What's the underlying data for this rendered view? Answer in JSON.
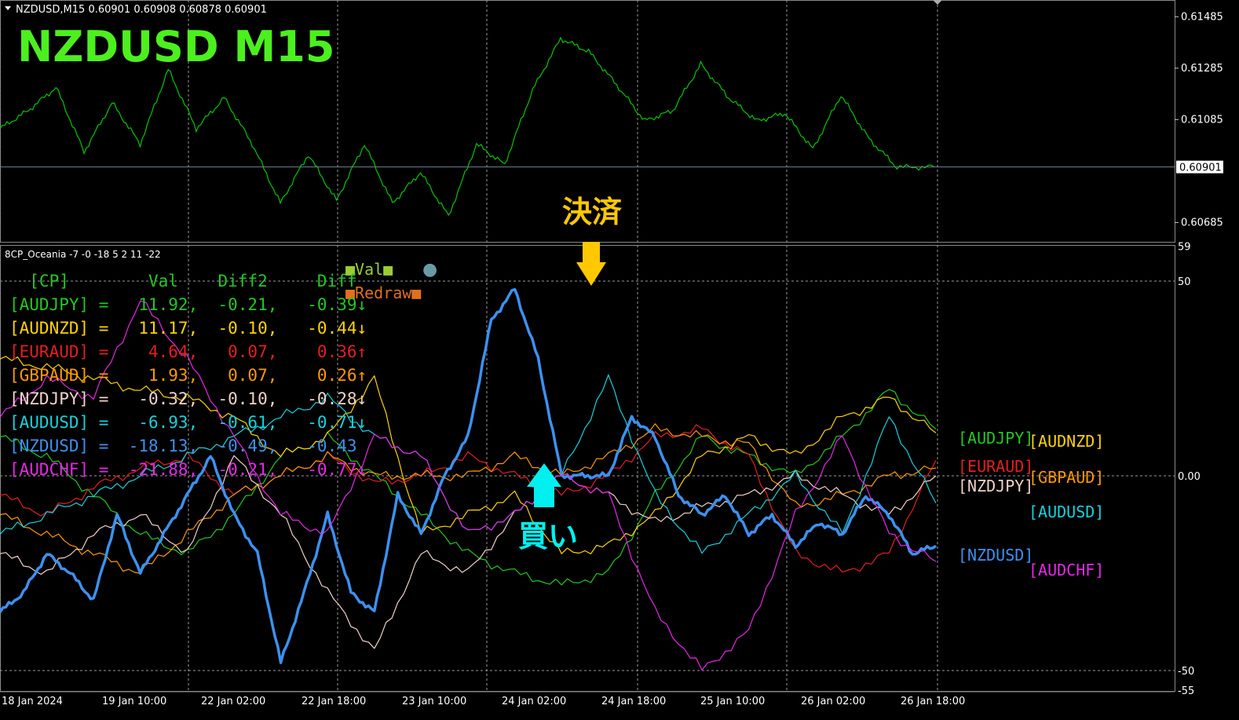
{
  "window": {
    "header": "NZDUSD,M15  0.60901 0.60908 0.60878 0.60901",
    "big_title": "NZDUSD  M15",
    "indicator_header": "8CP_Oceania -7 -0 -18 5 2 11 -22"
  },
  "price_axis": {
    "ticks": [
      "0.61485",
      "0.61285",
      "0.61085",
      "0.60685"
    ],
    "current_price": "0.60901"
  },
  "indicator_axis": {
    "ticks": [
      "59",
      "50",
      "0.00",
      "-50",
      "-55"
    ]
  },
  "time_axis": {
    "labels": [
      "18 Jan 2024",
      "19 Jan 10:00",
      "22 Jan 02:00",
      "22 Jan 18:00",
      "23 Jan 10:00",
      "24 Jan 02:00",
      "24 Jan 18:00",
      "25 Jan 10:00",
      "26 Jan 02:00",
      "26 Jan 18:00"
    ]
  },
  "annotations": {
    "settle": "決済",
    "buy": "買い",
    "legend_val": "■Val■",
    "legend_dot": "●",
    "legend_redraw": "■Redraw■"
  },
  "colors": {
    "price": "#00c800",
    "AUDJPY": "#22c822",
    "AUDNZD": "#ffd400",
    "EURAUD": "#e61e1e",
    "GBPAUD": "#ff9900",
    "NZDJPY": "#f0d2c8",
    "AUDUSD": "#17d2dc",
    "NZDUSD": "#3c91f0",
    "AUDCHF": "#e628e6",
    "cyan_arrow": "#00f0f0",
    "gold_arrow": "#ffc800"
  },
  "table": {
    "header": [
      "[CP]",
      "Val",
      "Diff2",
      "Diff"
    ],
    "rows": [
      {
        "pair": "[AUDJPY]",
        "val": "11.92,",
        "diff2": "-0.21,",
        "diff": "-0.39",
        "arrow": "↓",
        "color": "#22c822"
      },
      {
        "pair": "[AUDNZD]",
        "val": "11.17,",
        "diff2": "-0.10,",
        "diff": "-0.44",
        "arrow": "↓",
        "color": "#ffd400"
      },
      {
        "pair": "[EURAUD]",
        "val": "4.64,",
        "diff2": "0.07,",
        "diff": "0.36",
        "arrow": "↑",
        "color": "#e61e1e"
      },
      {
        "pair": "[GBPAUD]",
        "val": "1.93,",
        "diff2": "0.07,",
        "diff": "0.26",
        "arrow": "↑",
        "color": "#ff9900"
      },
      {
        "pair": "[NZDJPY]",
        "val": "-0.32,",
        "diff2": "-0.10,",
        "diff": "-0.28",
        "arrow": "↓",
        "color": "#f0d2c8"
      },
      {
        "pair": "[AUDUSD]",
        "val": "-6.93,",
        "diff2": "-0.61,",
        "diff": "-0.71",
        "arrow": "↓",
        "color": "#17d2dc"
      },
      {
        "pair": "[NZDUSD]",
        "val": "-18.13,",
        "diff2": "-0.49,",
        "diff": "-0.43",
        "arrow": "",
        "color": "#3c91f0"
      },
      {
        "pair": "[AUDCHF]",
        "val": "-21.88,",
        "diff2": "-0.21,",
        "diff": "-0.77",
        "arrow": "↓",
        "color": "#e628e6"
      }
    ]
  },
  "right_labels": [
    "[AUDJPY]",
    "[AUDNZD]",
    "[EURAUD]",
    "[GBPAUD]",
    "[NZDJPY]",
    "[AUDUSD]",
    "[NZDUSD]",
    "[AUDCHF]"
  ],
  "chart_data": [
    {
      "type": "line",
      "name": "NZDUSD M15",
      "ylim": [
        0.6061,
        0.6155
      ],
      "x": [
        0,
        0.03,
        0.06,
        0.09,
        0.12,
        0.15,
        0.18,
        0.21,
        0.24,
        0.27,
        0.3,
        0.33,
        0.36,
        0.39,
        0.42,
        0.45,
        0.48,
        0.51,
        0.54,
        0.57,
        0.6,
        0.63,
        0.66,
        0.69,
        0.72,
        0.75,
        0.78,
        0.81,
        0.84,
        0.87,
        0.9,
        0.93,
        0.96,
        1.0
      ],
      "values": [
        0.6105,
        0.6112,
        0.6121,
        0.6096,
        0.6115,
        0.6099,
        0.6128,
        0.6105,
        0.6117,
        0.6099,
        0.6076,
        0.6095,
        0.6077,
        0.6099,
        0.6076,
        0.6088,
        0.6071,
        0.6099,
        0.6091,
        0.612,
        0.614,
        0.6135,
        0.6122,
        0.6108,
        0.6112,
        0.613,
        0.6117,
        0.6108,
        0.6111,
        0.6097,
        0.6118,
        0.6101,
        0.609,
        0.60901
      ]
    },
    {
      "type": "line",
      "name": "8CP_Oceania",
      "ylim": [
        -55,
        59
      ],
      "series": [
        {
          "key": "AUDJPY",
          "x": [
            0,
            0.05,
            0.1,
            0.15,
            0.2,
            0.25,
            0.3,
            0.35,
            0.4,
            0.45,
            0.5,
            0.55,
            0.6,
            0.65,
            0.7,
            0.75,
            0.8,
            0.85,
            0.9,
            0.95,
            1.0
          ],
          "values": [
            10,
            5,
            -5,
            -15,
            -20,
            -10,
            5,
            10,
            0,
            -10,
            -20,
            -25,
            -28,
            -25,
            -5,
            10,
            5,
            0,
            10,
            22,
            12
          ]
        },
        {
          "key": "AUDNZD",
          "x": [
            0,
            0.05,
            0.1,
            0.15,
            0.2,
            0.25,
            0.3,
            0.35,
            0.4,
            0.45,
            0.5,
            0.55,
            0.6,
            0.65,
            0.7,
            0.75,
            0.8,
            0.85,
            0.9,
            0.95,
            1.0
          ],
          "values": [
            30,
            28,
            25,
            22,
            20,
            15,
            5,
            10,
            25,
            -15,
            -10,
            -5,
            -20,
            -18,
            -10,
            5,
            10,
            5,
            15,
            20,
            11
          ]
        },
        {
          "key": "EURAUD",
          "x": [
            0,
            0.05,
            0.1,
            0.15,
            0.2,
            0.25,
            0.3,
            0.35,
            0.4,
            0.45,
            0.5,
            0.55,
            0.6,
            0.65,
            0.7,
            0.75,
            0.8,
            0.85,
            0.9,
            0.95,
            1.0
          ],
          "values": [
            -5,
            -10,
            -3,
            2,
            5,
            -5,
            0,
            5,
            -2,
            0,
            5,
            0,
            -5,
            0,
            10,
            12,
            5,
            -20,
            -25,
            -20,
            4
          ]
        },
        {
          "key": "GBPAUD",
          "x": [
            0,
            0.05,
            0.1,
            0.15,
            0.2,
            0.25,
            0.3,
            0.35,
            0.4,
            0.45,
            0.5,
            0.55,
            0.6,
            0.65,
            0.7,
            0.75,
            0.8,
            0.85,
            0.9,
            0.95,
            1.0
          ],
          "values": [
            -10,
            -15,
            -20,
            -25,
            -15,
            -5,
            0,
            5,
            0,
            0,
            0,
            5,
            0,
            5,
            12,
            10,
            8,
            -8,
            -5,
            0,
            2
          ]
        },
        {
          "key": "NZDJPY",
          "x": [
            0,
            0.05,
            0.1,
            0.15,
            0.2,
            0.25,
            0.3,
            0.35,
            0.4,
            0.45,
            0.5,
            0.55,
            0.6,
            0.65,
            0.7,
            0.75,
            0.8,
            0.85,
            0.9,
            0.95,
            1.0
          ],
          "values": [
            -20,
            -25,
            -15,
            -10,
            -20,
            5,
            -10,
            -30,
            -45,
            -20,
            -25,
            -10,
            0,
            -5,
            -12,
            -8,
            -5,
            0,
            -5,
            -10,
            0
          ]
        },
        {
          "key": "AUDUSD",
          "x": [
            0,
            0.05,
            0.1,
            0.15,
            0.2,
            0.25,
            0.3,
            0.35,
            0.4,
            0.45,
            0.5,
            0.55,
            0.6,
            0.65,
            0.7,
            0.75,
            0.8,
            0.85,
            0.9,
            0.95,
            1.0
          ],
          "values": [
            -15,
            -10,
            -5,
            0,
            5,
            10,
            15,
            20,
            10,
            5,
            -15,
            -10,
            0,
            25,
            -5,
            -20,
            -10,
            0,
            -15,
            15,
            -7
          ]
        },
        {
          "key": "NZDUSD",
          "x": [
            0,
            0.025,
            0.05,
            0.075,
            0.1,
            0.125,
            0.15,
            0.175,
            0.2,
            0.225,
            0.25,
            0.275,
            0.3,
            0.325,
            0.35,
            0.375,
            0.4,
            0.425,
            0.45,
            0.475,
            0.5,
            0.525,
            0.55,
            0.575,
            0.6,
            0.625,
            0.65,
            0.675,
            0.7,
            0.725,
            0.75,
            0.775,
            0.8,
            0.825,
            0.85,
            0.875,
            0.9,
            0.925,
            0.95,
            0.975,
            1.0
          ],
          "values": [
            -35,
            -30,
            -20,
            -25,
            -32,
            -10,
            -25,
            -15,
            -5,
            5,
            -10,
            -20,
            -48,
            -30,
            -10,
            -30,
            -35,
            -5,
            -15,
            0,
            10,
            40,
            48,
            30,
            0,
            0,
            0,
            15,
            10,
            -5,
            -10,
            -5,
            -15,
            -10,
            -18,
            -12,
            -15,
            -5,
            -10,
            -20,
            -18
          ]
        },
        {
          "key": "AUDCHF",
          "x": [
            0,
            0.05,
            0.1,
            0.15,
            0.2,
            0.25,
            0.3,
            0.35,
            0.4,
            0.45,
            0.5,
            0.55,
            0.6,
            0.65,
            0.7,
            0.75,
            0.8,
            0.85,
            0.9,
            0.95,
            1.0
          ],
          "values": [
            15,
            25,
            20,
            45,
            30,
            10,
            -10,
            -15,
            10,
            5,
            -15,
            -10,
            0,
            -5,
            -35,
            -50,
            -40,
            -10,
            10,
            -15,
            -22
          ]
        }
      ]
    }
  ]
}
